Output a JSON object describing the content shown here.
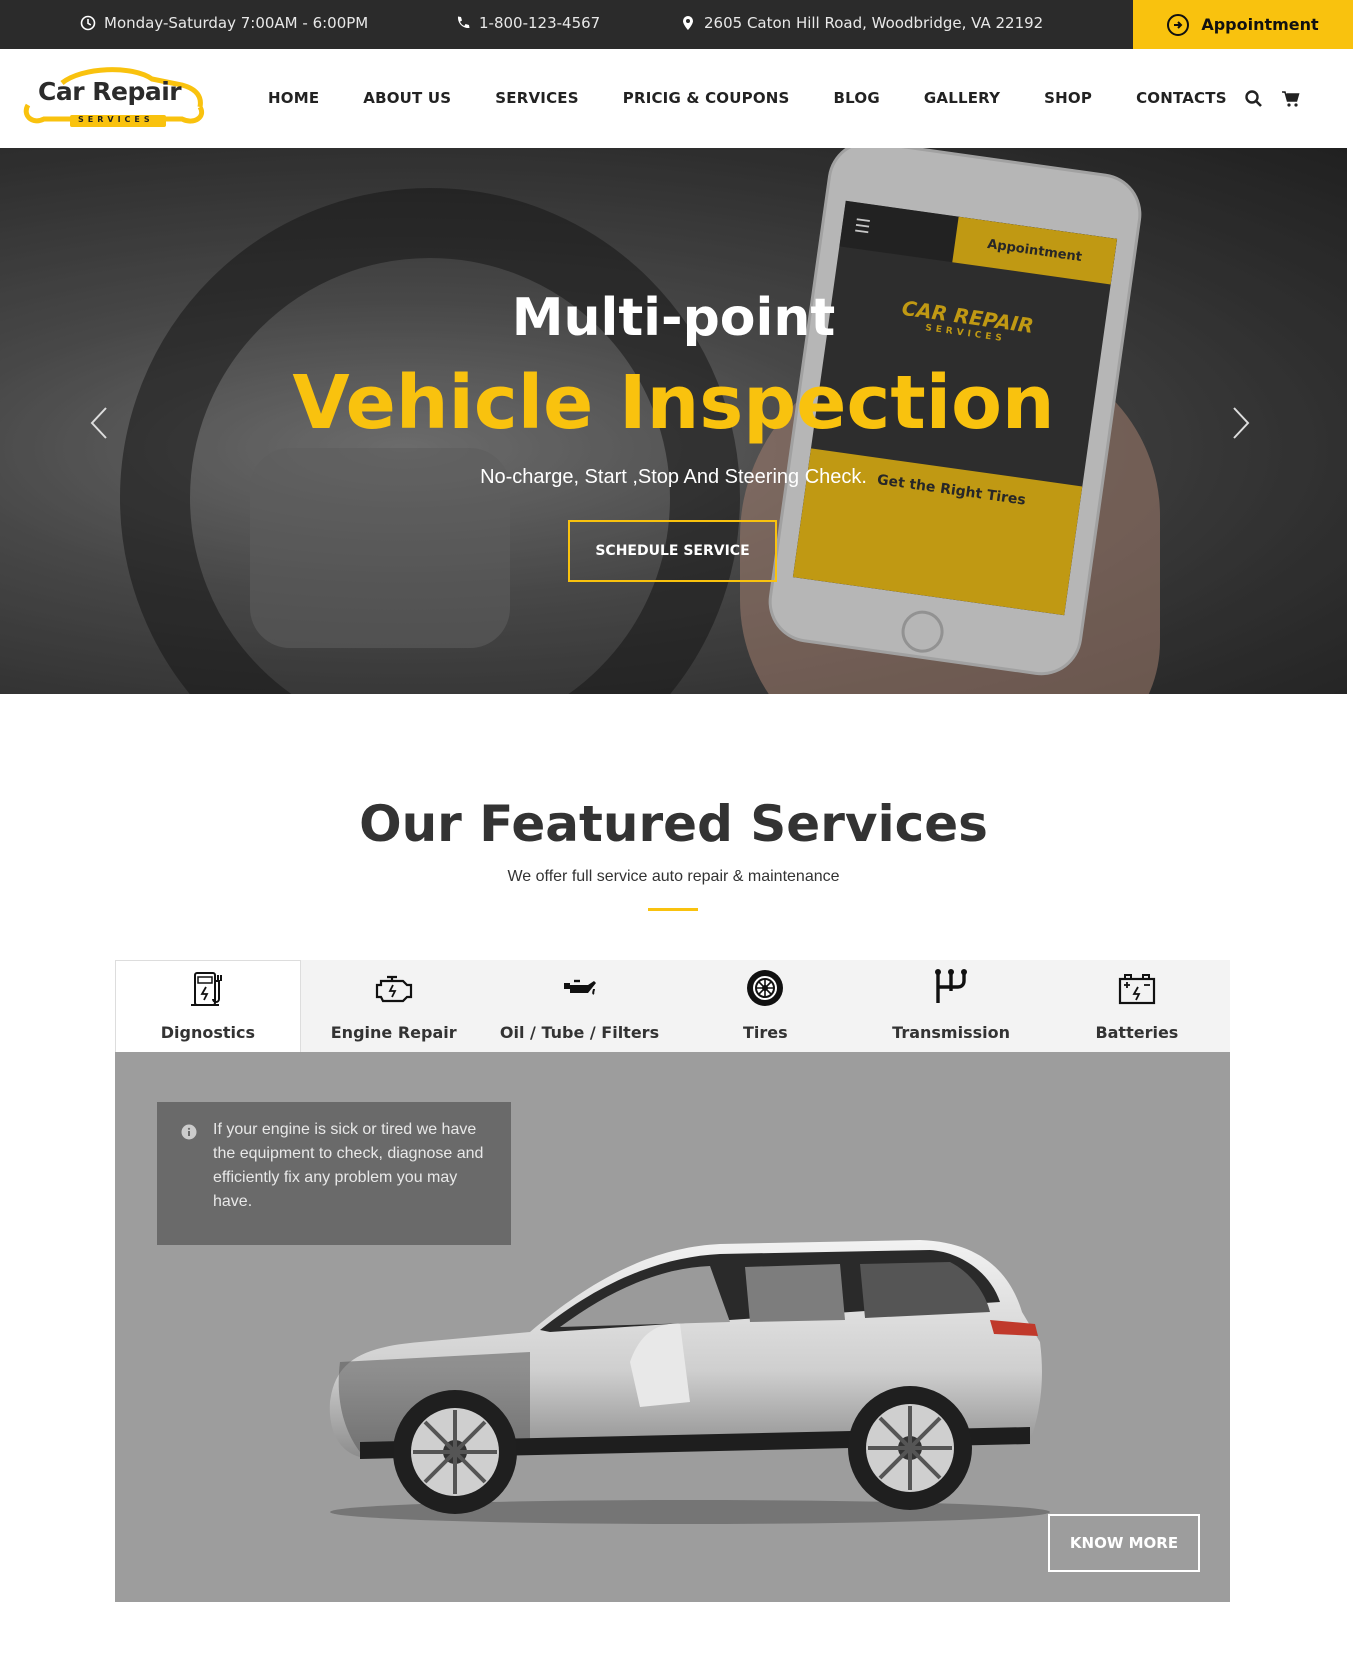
{
  "topbar": {
    "hours": "Monday-Saturday 7:00AM - 6:00PM",
    "phone": "1-800-123-4567",
    "address": "2605 Caton Hill Road, Woodbridge, VA 22192",
    "appointment_label": "Appointment",
    "accent_color": "#f9c20e"
  },
  "logo": {
    "title": "Car Repair",
    "subtitle": "SERVICES"
  },
  "nav": {
    "items": [
      "HOME",
      "ABOUT US",
      "SERVICES",
      "PRICIG & COUPONS",
      "BLOG",
      "GALLERY",
      "SHOP",
      "CONTACTS"
    ],
    "icons": [
      "search-icon",
      "cart-icon"
    ]
  },
  "hero": {
    "title_line1": "Multi-point",
    "title_line2": "Vehicle Inspection",
    "subtitle": "No-charge, Start ,Stop And Steering Check.",
    "button_label": "SCHEDULE SERVICE",
    "phone_screen": {
      "appointment_label": "Appointment",
      "logo_text": "CAR REPAIR",
      "logo_sub": "SERVICES",
      "tires_text": "Get the Right Tires"
    }
  },
  "featured": {
    "title": "Our Featured Services",
    "subtitle": "We offer full service auto repair & maintenance",
    "tabs": [
      {
        "label": "Dignostics",
        "icon": "diagnostics-icon"
      },
      {
        "label": "Engine Repair",
        "icon": "engine-icon"
      },
      {
        "label": "Oil / Tube / Filters",
        "icon": "oil-can-icon"
      },
      {
        "label": "Tires",
        "icon": "tire-icon"
      },
      {
        "label": "Transmission",
        "icon": "transmission-icon"
      },
      {
        "label": "Batteries",
        "icon": "battery-icon"
      }
    ],
    "active_tab": 0,
    "panel_text": "If your engine is sick or tired we have the equipment to check, diagnose and efficiently fix any problem you may have.",
    "button_label": "KNOW MORE"
  }
}
